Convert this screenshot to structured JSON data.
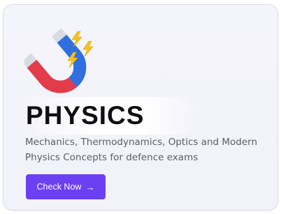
{
  "card": {
    "title": "PHYSICS",
    "description": "Mechanics, Thermodynamics, Optics and Modern Physics Concepts for defence exams",
    "button_label": "Check Now",
    "button_arrow": "→",
    "icon": "magnet-with-lightning-icon"
  },
  "colors": {
    "accent": "#6b3ff2",
    "magnet_red": "#e23b4a",
    "magnet_blue": "#2f6fe0",
    "bolt_yellow": "#f7c21a"
  }
}
